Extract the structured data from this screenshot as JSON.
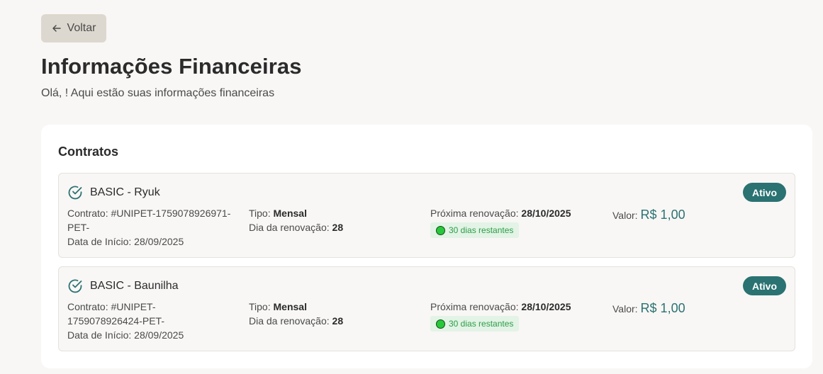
{
  "header": {
    "back_label": "Voltar",
    "title": "Informações Financeiras",
    "subtitle": "Olá, ! Aqui estão suas informações financeiras"
  },
  "contracts_panel": {
    "title": "Contratos",
    "items": [
      {
        "name": "BASIC - Ryuk",
        "status": "Ativo",
        "contract_label": "Contrato:",
        "contract_line1": "#UNIPET-1759078926971-",
        "contract_line2": "PET-",
        "start_label": "Data de Início:",
        "start_date": "28/09/2025",
        "type_label": "Tipo:",
        "type_value": "Mensal",
        "renew_day_label": "Dia da renovação:",
        "renew_day_value": "28",
        "next_renew_label": "Próxima renovação:",
        "next_renew_value": "28/10/2025",
        "days_left": "30 dias restantes",
        "value_label": "Valor:",
        "value_amount": "R$ 1,00"
      },
      {
        "name": "BASIC - Baunilha",
        "status": "Ativo",
        "contract_label": "Contrato:",
        "contract_line1": "#UNIPET-",
        "contract_line2": "1759078926424-PET-",
        "start_label": "Data de Início:",
        "start_date": "28/09/2025",
        "type_label": "Tipo:",
        "type_value": "Mensal",
        "renew_day_label": "Dia da renovação:",
        "renew_day_value": "28",
        "next_renew_label": "Próxima renovação:",
        "next_renew_value": "28/10/2025",
        "days_left": "30 dias restantes",
        "value_label": "Valor:",
        "value_amount": "R$ 1,00"
      }
    ]
  },
  "colors": {
    "accent": "#2b7272",
    "status_dot": "#28c83c",
    "days_text": "#2a9e45",
    "back_button_bg": "#ddd8cf"
  },
  "icons": {
    "back": "arrow-left-icon",
    "check": "check-circle-icon",
    "status_dot": "green-dot-icon"
  }
}
